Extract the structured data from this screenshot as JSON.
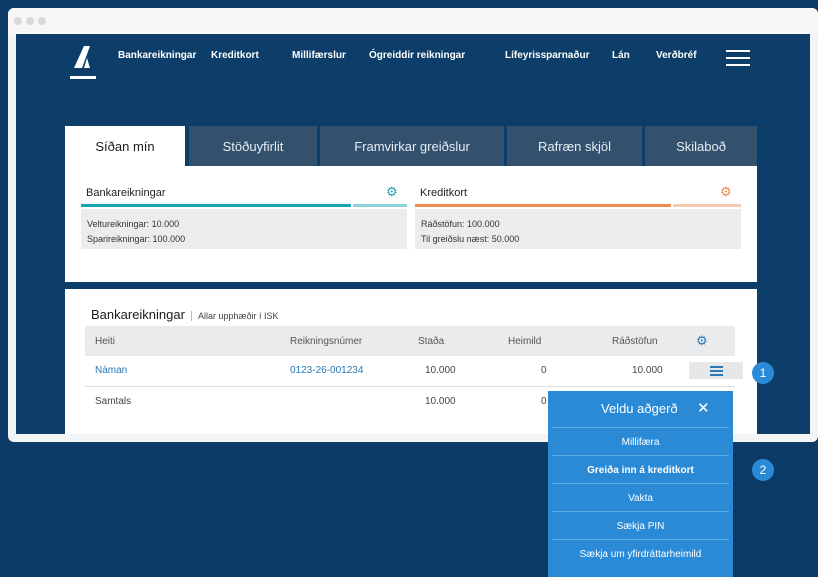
{
  "nav": {
    "items": [
      "Bankareikningar",
      "Kreditkort",
      "Millifærslur",
      "Ógreiddir reikningar",
      "Lífeyrissparnaður",
      "Lán",
      "Verðbréf"
    ]
  },
  "tabs": [
    "Síðan mín",
    "Stöðuyfirlit",
    "Framvirkar greiðslur",
    "Rafræn skjöl",
    "Skilaboð"
  ],
  "summary": {
    "bank": {
      "title": "Bankareikningar",
      "line1_label": "Veltureikningar:",
      "line1_value": "10.000",
      "line2_label": "Sparireikningar:",
      "line2_value": "100.000"
    },
    "card": {
      "title": "Kreditkort",
      "line1_label": "Ráðstöfun:",
      "line1_value": "100.000",
      "line2_label": "Til greiðslu næst:",
      "line2_value": "50.000"
    }
  },
  "accounts": {
    "title": "Bankareikningar",
    "subtitle": "Allar upphæðir í ISK",
    "columns": [
      "Heiti",
      "Reikningsnúmer",
      "Staða",
      "Heimild",
      "Ráðstöfun"
    ],
    "rows": [
      {
        "name": "Náman",
        "number": "0123-26-001234",
        "balance": "10.000",
        "limit": "0",
        "available": "10.000"
      }
    ],
    "total": {
      "label": "Samtals",
      "balance": "10.000",
      "limit": "0"
    }
  },
  "dropdown": {
    "title": "Veldu aðgerð",
    "items": [
      "Millifæra",
      "Greiða inn á kreditkort",
      "Vakta",
      "Sækja PIN",
      "Sækja um yfirdráttarheimild"
    ]
  },
  "badges": [
    "1",
    "2"
  ],
  "colors": {
    "bank_accent": "#1aa3b3",
    "card_accent": "#f08a4b",
    "menu_blue": "#2a8ad6"
  }
}
